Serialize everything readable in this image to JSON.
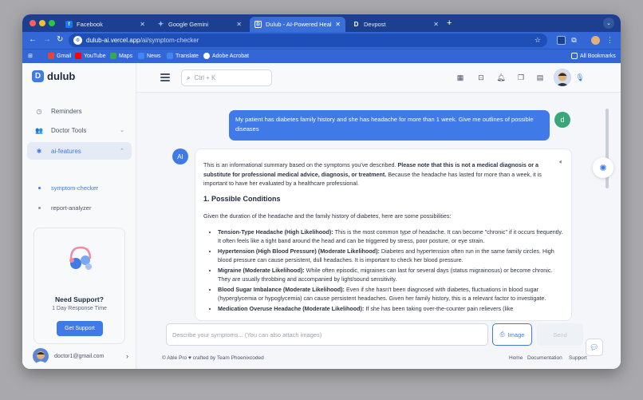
{
  "browser": {
    "tabs": [
      {
        "label": "Facebook",
        "favicon": "facebook-icon",
        "color": "#1877f2",
        "active": false
      },
      {
        "label": "Google Gemini",
        "favicon": "gemini-icon",
        "color": "#8ab4f8",
        "active": false
      },
      {
        "label": "Dulub - AI-Powered Heal",
        "favicon": "dulub-icon",
        "color": "#3f7ae8",
        "active": true
      },
      {
        "label": "Devpost",
        "favicon": "devpost-icon",
        "color": "#003e54",
        "active": false
      }
    ],
    "url_host": "dulub-ai.vercel.app",
    "url_path": "/ai/symptom-checker",
    "bookmarks": [
      "Gmail",
      "YouTube",
      "Maps",
      "News",
      "Translate",
      "Adobe Acrobat"
    ],
    "all_bookmarks": "All Bookmarks"
  },
  "app": {
    "logo_letter": "D",
    "logo_word": "dulub",
    "nav": {
      "reminders": "Reminders",
      "doctor_tools": "Doctor Tools",
      "ai_features": "ai-features",
      "symptom_checker": "symptom-checker",
      "report_analyzer": "report-analyzer"
    },
    "support": {
      "title": "Need Support?",
      "subtitle": "1 Day Response Time",
      "button": "Get Support"
    },
    "user_email": "doctor1@gmail.com",
    "search_placeholder": "Ctrl + K"
  },
  "chat": {
    "user_badge": "d",
    "ai_badge": "AI",
    "user_message": "My patient has diabetes family history and she has headache for more than 1 week. Give me outlines of possible diseases",
    "ai_intro_plain": "This is an informational summary based on the symptoms you've described. ",
    "ai_intro_bold": "Please note that this is not a medical diagnosis or a substitute for professional medical advice, diagnosis, or treatment.",
    "ai_intro_tail": " Because the headache has lasted for more than a week, it is important to have her evaluated by a healthcare professional.",
    "section_title": "1. Possible Conditions",
    "section_lead": "Given the duration of the headache and the family history of diabetes, here are some possibilities:",
    "conditions": [
      {
        "name": "Tension-Type Headache (High Likelihood):",
        "text": " This is the most common type of headache. It can become \"chronic\" if it occurs frequently. It often feels like a tight band around the head and can be triggered by stress, poor posture, or eye strain."
      },
      {
        "name": "Hypertension (High Blood Pressure) (Moderate Likelihood):",
        "text": " Diabetes and hypertension often run in the same family circles. High blood pressure can cause persistent, dull headaches. It is important to check her blood pressure."
      },
      {
        "name": "Migraine (Moderate Likelihood):",
        "text": " While often episodic, migraines can last for several days (status migrainosus) or become chronic. They are usually throbbing and accompanied by light/sound sensitivity."
      },
      {
        "name": "Blood Sugar Imbalance (Moderate Likelihood):",
        "text": " Even if she hasn't been diagnosed with diabetes, fluctuations in blood sugar (hyperglycemia or hypoglycemia) can cause persistent headaches. Given her family history, this is a relevant factor to investigate."
      },
      {
        "name": "Medication Overuse Headache (Moderate Likelihood):",
        "text": " If she has been taking over-the-counter pain relievers (like"
      }
    ],
    "composer_placeholder": "Describe your symptoms... (You can also attach images)",
    "image_button": "Image",
    "send_button": "Send"
  },
  "footer": {
    "credit": "© Able Pro ♥ crafted by Team Phoenixcoded",
    "links": [
      "Home",
      "Documentation",
      "Support"
    ]
  }
}
